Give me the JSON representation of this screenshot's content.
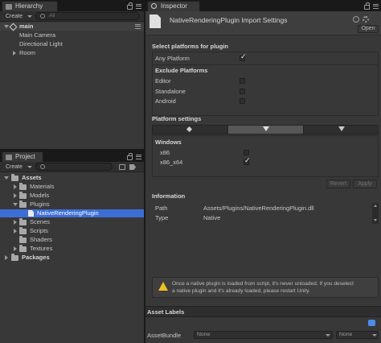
{
  "hierarchy": {
    "tab": "Hierarchy",
    "create_label": "Create",
    "search_placeholder": "All",
    "scene_name": "main",
    "items": [
      "Main Camera",
      "Directional Light",
      "Room"
    ]
  },
  "project": {
    "tab": "Project",
    "create_label": "Create",
    "items": {
      "assets": "Assets",
      "materials": "Materials",
      "models": "Models",
      "plugins": "Plugins",
      "selected_plugin": "NativeRenderingPlugin",
      "scenes": "Scenes",
      "scripts": "Scripts",
      "shaders": "Shaders",
      "textures": "Textures",
      "packages": "Packages"
    }
  },
  "inspector": {
    "tab": "Inspector",
    "title": "NativeRenderingPlugin Import Settings",
    "open_label": "Open",
    "select_platforms_header": "Select platforms for plugin",
    "any_platform": "Any Platform",
    "exclude_header": "Exclude Platforms",
    "exclude": [
      "Editor",
      "Standalone",
      "Android"
    ],
    "platform_settings_header": "Platform settings",
    "windows_header": "Windows",
    "arch": [
      "x86",
      "x86_x64"
    ],
    "revert_label": "Revert",
    "apply_label": "Apply",
    "information_header": "Information",
    "path_label": "Path",
    "path_value": "Assets/Plugins/NativeRenderingPlugin.dll",
    "type_label": "Type",
    "type_value": "Native",
    "warning_line1": "Once a native plugin is loaded from script, it's never unloaded. If you deselect",
    "warning_line2": "a native plugin and it's already loaded, please restart Unity.",
    "asset_labels_header": "Asset Labels",
    "asset_bundle_label": "AssetBundle",
    "asset_bundle_value": "None",
    "asset_bundle_variant": "None"
  },
  "colors": {
    "selection": "#3d6ed6",
    "panel": "#383838",
    "warning": "#f0c020"
  }
}
